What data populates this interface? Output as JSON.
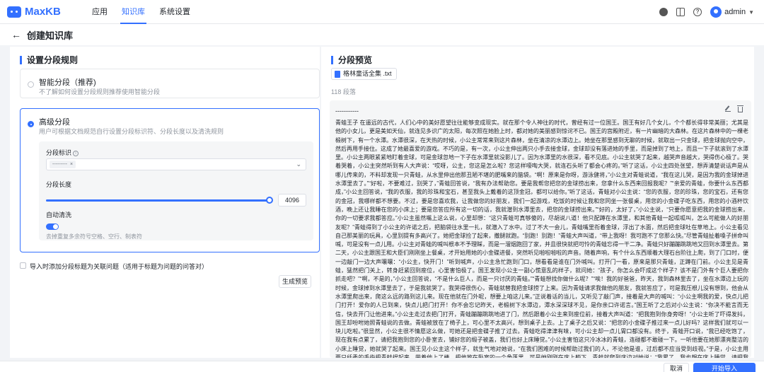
{
  "app": {
    "name": "MaxKB"
  },
  "nav": {
    "items": [
      "应用",
      "知识库",
      "系统设置"
    ],
    "active_index": 1
  },
  "user": {
    "name": "admin"
  },
  "page": {
    "title": "创建知识库"
  },
  "left": {
    "section_title": "设置分段规则",
    "smart": {
      "title": "智能分段（推荐)",
      "desc": "不了解如何设置分段规则推荐使用智能分段"
    },
    "advanced": {
      "title": "高级分段",
      "desc": "用户可根据文档规范自行设置分段标识符、分段长度以及清洗规则",
      "identifier_label": "分段标识",
      "identifier_tag": "---------",
      "length_label": "分段长度",
      "length_value": "4096",
      "length_fraction": 1.0,
      "clean_label": "自动清洗",
      "clean_desc": "去掉重复多余符号空格、空行、制表符"
    },
    "checkbox_label": "导入时添加分段标题为关联问题（适用于标题为问题的问答对）",
    "preview_button": "生成预览"
  },
  "right": {
    "section_title": "分段预览",
    "file_name": "格林童话全集 .txt",
    "segment_count": "118 段落",
    "segment_header": "-----------",
    "segment_text": "青蛙王子 在遥远的古代，人们心中的美好愿望往往能够变成现实。就在那个令人神往的时代，曾经有过一位国王。国王有好几个女儿，个个都长得非常美丽；尤其是他的小女儿，更是美如天仙，就连见多识广的太阳，每次照在她脸上时，都对她的美丽感到惊诧不已。国王的宫殿附近，有一片幽暗的大森林。在这片森林中的一棵老椴树下，有一个水潭。水潭很深，在天热的时候，小公主常常来到这片森林，坐在清凉的水潭边上。她坐在那里感到无聊的时候，就取出一只金球，把金球抛向空中，然后再用手接住。这成了她最喜爱的游戏。不巧的是，有一次，小公主伸出两只小手去接金球，金球却没有落进她的手里，而是掉到了地上，而且一下子就滚到了水潭里。小公主两眼紧紧地盯着金球，可是金球忽地一下子在水潭里就没影儿了。因为水潭里的水很深，看不见底。小公主就哭了起来，越哭声音越大，哭得伤心极了。哭着哭着，小公主突然听到有人大声说：“哎呀，公主，您这是怎么啦？您这样嚎啕大哭，就连石头听了都会心疼的。”听了这话，小公主四处张望，想弄清楚说话声是从哪儿传来的，不料却发现一只青蛙，从水里伸出他那丑陋不堪的肥嘴来的脑袋。“啊！原来是你呀，游泳健将，”小公主对青蛙说道，“我在这儿哭，是因为我的金球掉进水潭里去了。”“好啦，不要难过，别哭了，”青蛙回答说，“我有办法帮助您。要是我帮您把您的金球捞出来，您拿什么东西来回报我呢？”“亲爱的青蛙，你要什么东西都成，”小公主回答说，“我的衣服，我的珍珠和宝石，甚至我头上戴着的这顶金冠，都可以给你。”听了这话，青蛙对小公主说：“您的衣服，您的珍珠，您的宝石，还有您的金冠，我哪样都不想要。不过，要是您喜欢我，让我做您的好朋友，我们一起游戏，吃饭的时候让我和您同坐一张餐桌，用您的小金碟子吃东西，用您的小酒杯饮酒，晚上还让我睡在您的小床上；要是您答应所有这一切的话，我就潜到水潭里去，把您的金球捞出来。”“好的，太好了，”小公主说，“只要你愿意把我的金球捞出来，你的一切要求我都答应。”小公主虽然嘴上这么说，心里却想：“这只青蛙可真够傻的，尽胡说八道！他只配蹲在水潭里，和其他青蛙一起呱呱叫，怎么可能做人的好朋友呢？”青蛙得到了小公主的许诺之后，把脑袋往水里一扎，就潜入了水中。过了不大一会儿，青蛙嘴里衔着金球，浮出了水面，然后把金球吐在草地上。小公主看见自己那美丽的玩具，心里别提有多高兴了。她把金球捡了起来，撒腿就跑。“别跑！别跑！”青蛙大声叫道，“带上我呀！我可跑不了您那么快。”尽管青蛙扯着嗓子拼命叫喊，可是没有一点儿用。小公主对青蛙的喊叫根本不予理睬，而是一溜烟跑回了家，并且很快就把可怜的青蛙忘得一干二净。青蛙只好蹦蹦跳跳地又回到水潭里去。第二天，小公主跟国王和大臣们刚刚坐上餐桌，才开始用她的小金碟进餐，突然听见啪啦啪啦的声音。随着声响，有个什么东西顺着大理石台阶往上爬，到了门口时，便一边敲门一边大声嚷嚷：“小公主，快开门！”听到喊声，小公主急忙跑到门口，想看看是谁在门外喊叫。打开门一看，原来是那只青蛙，正蹲在门前。小公主见是青蛙，猛然把门关上，转身赶紧回到座位，心里害怕极了。国王发现小公主一副心慌意乱的样子，就问她：“孩子，你怎么会吓成这个样子？该不是门外有个巨人要把你抓走吧？”“啊，不是的，”小公主回答说，“不是什么巨人，而是一只讨厌的青蛙。”“青蛙想找你做什么呢？”“唉！我的好爸爸，昨天，我到森林里去了，坐在水潭边上玩的时候，金球掉到水潭里去了，于是我就哭了。我哭得很伤心，青蛙就替我把金球捞了上来。因为青蛙请求我做他的朋友，我就答应了，可是我压根儿没有想到，他会从水潭里爬出来，爬这么远的路到这儿来。现在他就在门外呢，想要上咱这儿来。”正说着话的当儿，又听见了敲门声，接着是大声的喊叫：“小公主啊我的爱，快点儿把门打开！爱你的人已到来，快点儿把门打开！你不会忘记昨天，老椴树下水潭边，潭水深深球不见，是你亲口许诺言。”国王听了之后对小公主说：“你决不能言而无信，快去开门让他进来。”小公主走过去把门打开，青蛙蹦蹦跳跳地进了门，然后跟着小公主来到座位前，接着大声叫道：“把我抱到你身旁呀！”小公主听了吓得发抖，国王却吩咐她照青蛙说的去做。青蛙被放在了椅子上，可心里不太高兴，想到桌子上去。上了桌子之后又说：“把您的小金碟子推过来一点儿好吗？这样我们就可以一块儿吃啦。”很显然，小公主很不情愿这么做，可她还是把金碟子推了过去。青蛙吃得津津有味，可小公主却一点儿胃口都没有。终于，青蛙开口说，“我已经吃饱了，现在我有点累了，请把我抱到您的小卧室去，铺好您的缎子被盖，我们也好上床睡觉。”小公主害怕这只冷冰冰的青蛙，连碰都不敢碰一下。一听他要在她那漂亮整洁的小床上睡觉，她就哭了起来。国王见小公主这个样子，就生气地对她说，“在我们困难的时候帮助过我们的人，不论他是谁，过后都不应当受到歧视。”于是，小公主用两只纤秀的手指把青蛙捏起来，带着他上了楼，把他放在卧室的一个角落里。可是她刚刚在床上躺下，青蛙就爬到床边对她说：“我累了，我也想在床上睡觉。请把我抱上来，要不我就告诉您父亲。”一听这话，小公主勃然大怒，一把抓起青蛙，朝墙上死劲儿摔去。“现在你想睡就去睡吧，你这个丑陋的讨厌鬼！”谁知他一落地，已不再是什么青蛙，却一下子变成了一位王子：一位两眼炯炯有神、满面笑容的王子。"
  },
  "footer": {
    "cancel": "取消",
    "create": "开始导入"
  },
  "colors": {
    "primary": "#3370ff"
  },
  "icons": [
    "github-icon",
    "book-icon",
    "help-icon",
    "avatar-icon",
    "back-arrow-icon",
    "info-icon",
    "file-icon",
    "edit-icon",
    "trash-icon"
  ]
}
